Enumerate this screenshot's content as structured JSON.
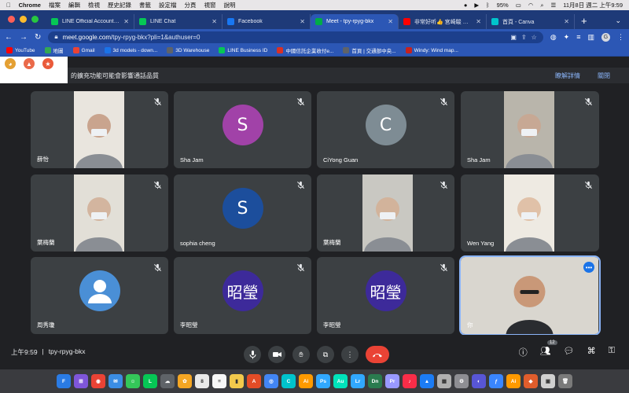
{
  "menubar": {
    "app": "Chrome",
    "items": [
      "檔案",
      "編輯",
      "檢視",
      "歷史記錄",
      "書籤",
      "設定檔",
      "分頁",
      "視窗",
      "說明"
    ],
    "battery": "95%",
    "clock": "11月8日 週二 上午9:59"
  },
  "tabs": [
    {
      "title": "LINE Official Account Ma",
      "color": "#06c755",
      "active": false
    },
    {
      "title": "LINE Chat",
      "color": "#06c755",
      "active": false
    },
    {
      "title": "Facebook",
      "color": "#1877f2",
      "active": false
    },
    {
      "title": "Meet - tpy-rpyg-bkx",
      "color": "#00ac47",
      "active": true
    },
    {
      "title": "非常好听👍 宮崎駿 水晶...",
      "color": "#ff0000",
      "active": false
    },
    {
      "title": "首頁 - Canva",
      "color": "#00c4cc",
      "active": false
    }
  ],
  "address": {
    "host": "meet.google.com",
    "path": "/tpy-rpyg-bkx?pli=1&authuser=0"
  },
  "bookmarks": [
    {
      "label": "YouTube",
      "color": "#ff0000"
    },
    {
      "label": "地圖",
      "color": "#34a853"
    },
    {
      "label": "Gmail",
      "color": "#ea4335"
    },
    {
      "label": "3d models - down...",
      "color": "#1a73e8"
    },
    {
      "label": "3D Warehouse",
      "color": "#5f6368"
    },
    {
      "label": "LINE Business ID",
      "color": "#06c755"
    },
    {
      "label": "中國信託企業收付e...",
      "color": "#d93025"
    },
    {
      "label": "首頁 | 交通部中央...",
      "color": "#5f6368"
    },
    {
      "label": "Windy: Wind map...",
      "color": "#c5221f"
    }
  ],
  "banner": {
    "text": "的擴充功能可能會影響通話品質",
    "learn_more": "瞭解詳情",
    "close": "關閉"
  },
  "participants": [
    {
      "name": "薛怡",
      "type": "video",
      "skin": "#c9a48e",
      "bg": "#e9e5de"
    },
    {
      "name": "Sha Jam",
      "type": "avatar",
      "initial": "S",
      "color": "#a142a8"
    },
    {
      "name": "CiYong Guan",
      "type": "avatar",
      "initial": "C",
      "color": "#7e8c94"
    },
    {
      "name": "Sha Jam",
      "type": "video",
      "skin": "#c7a894",
      "bg": "#b9b5ab"
    },
    {
      "name": "葉梅蘭",
      "type": "video",
      "skin": "#d3b59f",
      "bg": "#e2dfd7"
    },
    {
      "name": "sophia cheng",
      "type": "avatar",
      "initial": "S",
      "color": "#1c4e9c"
    },
    {
      "name": "葉梅蘭",
      "type": "video",
      "skin": "#d2b39b",
      "bg": "#c9c8c2"
    },
    {
      "name": "Wen Yang",
      "type": "video",
      "skin": "#e0c1a8",
      "bg": "#eeeae2"
    },
    {
      "name": "周秀瓊",
      "type": "avatar",
      "initial": "",
      "color": "#4a8fd6"
    },
    {
      "name": "李昭瑩",
      "type": "avatar",
      "initial": "昭瑩",
      "color": "#3d2a9a"
    },
    {
      "name": "李昭瑩",
      "type": "avatar",
      "initial": "昭瑩",
      "color": "#3d2a9a"
    },
    {
      "name": "你",
      "type": "self",
      "skin": "#c99878",
      "bg": "#d9d6cf"
    }
  ],
  "bottom": {
    "time": "上午9:59",
    "separator": "|",
    "code": "tpy-rpyg-bkx",
    "people_count": "12"
  },
  "dock": [
    {
      "label": "F",
      "color": "#2a7be4"
    },
    {
      "label": "⊞",
      "color": "#7f56d9"
    },
    {
      "label": "◉",
      "color": "#ea4335"
    },
    {
      "label": "✉",
      "color": "#3b8de4"
    },
    {
      "label": "☺",
      "color": "#34c759"
    },
    {
      "label": "L",
      "color": "#06c755"
    },
    {
      "label": "☁",
      "color": "#5f6368"
    },
    {
      "label": "✿",
      "color": "#f5a623"
    },
    {
      "label": "8",
      "color": "#e9e9e9"
    },
    {
      "label": "≡",
      "color": "#f7f7f7"
    },
    {
      "label": "▮",
      "color": "#f2c94c"
    },
    {
      "label": "A",
      "color": "#e34c26"
    },
    {
      "label": "◎",
      "color": "#4285f4"
    },
    {
      "label": "C",
      "color": "#00c4cc"
    },
    {
      "label": "Ai",
      "color": "#ff9a00"
    },
    {
      "label": "Ps",
      "color": "#31a8ff"
    },
    {
      "label": "Au",
      "color": "#00e4bb"
    },
    {
      "label": "Lr",
      "color": "#31a8ff"
    },
    {
      "label": "Dn",
      "color": "#2a7b4f"
    },
    {
      "label": "Pr",
      "color": "#9999ff"
    },
    {
      "label": "♪",
      "color": "#fa2d48"
    },
    {
      "label": "▲",
      "color": "#1c7cf4"
    },
    {
      "label": "▦",
      "color": "#b0b0b0"
    },
    {
      "label": "⚙",
      "color": "#8e8e93"
    },
    {
      "label": "◐",
      "color": "#5856d6"
    },
    {
      "label": "ƒ",
      "color": "#3a86ff"
    },
    {
      "label": "Ai",
      "color": "#ff9a00"
    },
    {
      "label": "◆",
      "color": "#e05d2c"
    },
    {
      "label": "▣",
      "color": "#d0d0d0"
    },
    {
      "label": "🗑",
      "color": "#7a7a7a"
    }
  ]
}
